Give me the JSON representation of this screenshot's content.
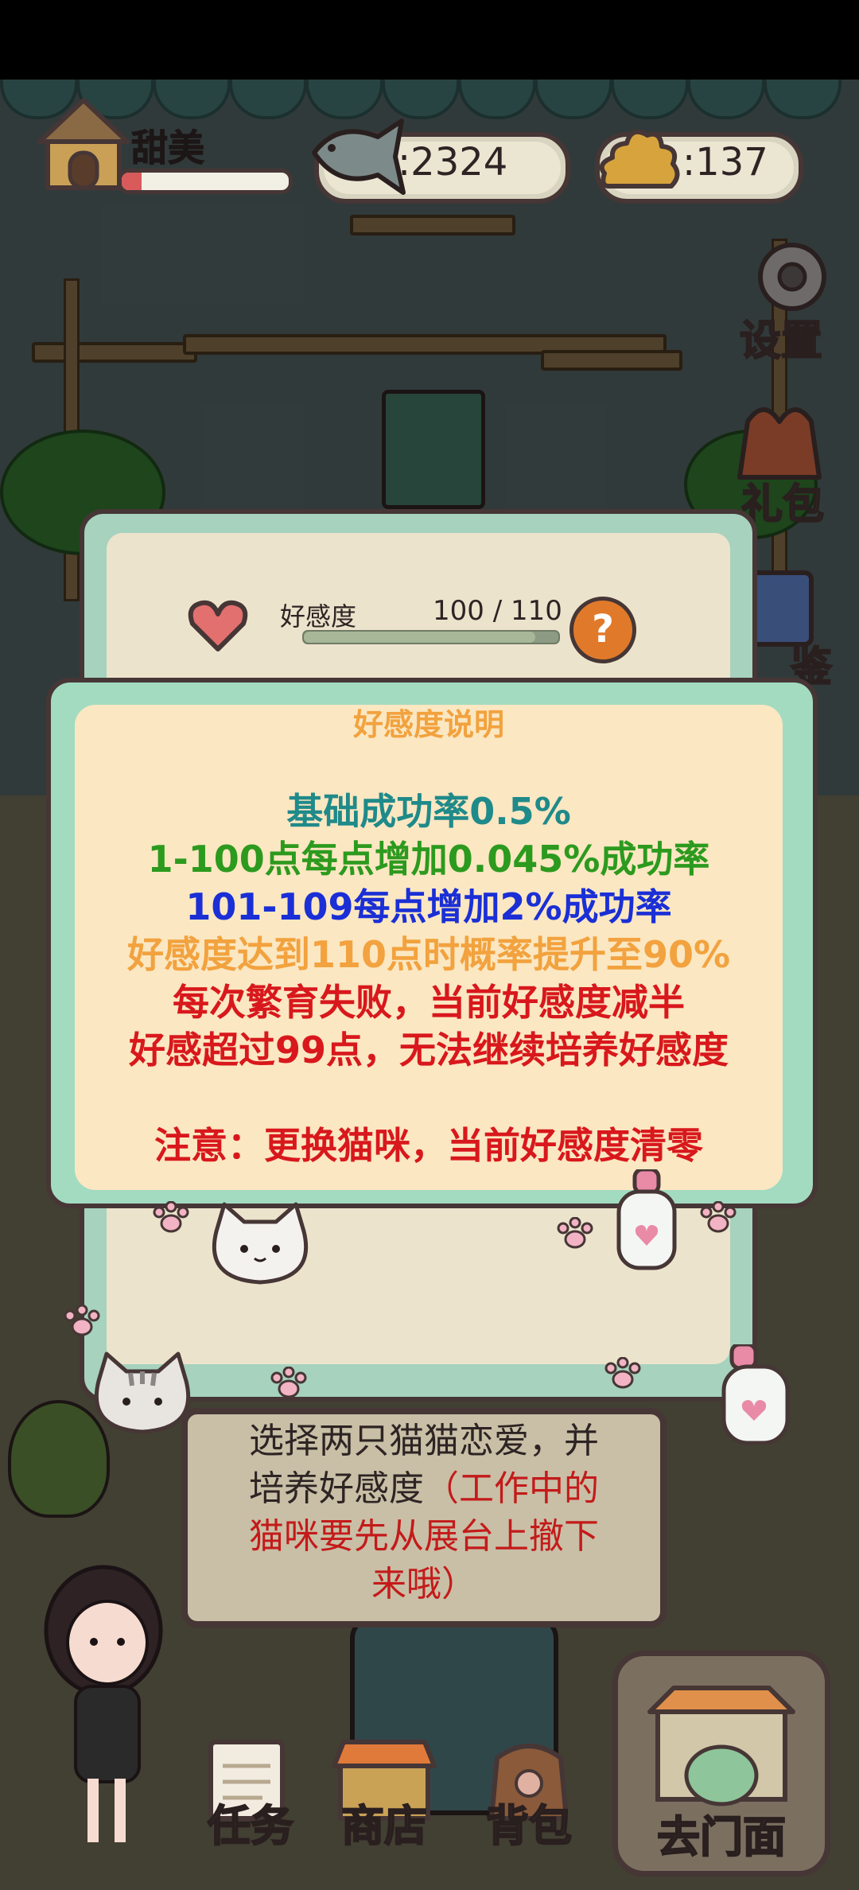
{
  "player": {
    "name": "甜美",
    "level_progress": 0.12
  },
  "resources": {
    "fish_count": "2324",
    "poop_count": "137",
    "fish_icon": "fish-icon",
    "poop_icon": "poop-icon"
  },
  "side_menu": [
    {
      "label": "设置",
      "icon": "gear-icon"
    },
    {
      "label": "礼包",
      "icon": "gift-bag-icon"
    },
    {
      "label": "鉴",
      "icon": "catalog-book-icon"
    }
  ],
  "affection": {
    "label": "好感度",
    "value": "100 / 110",
    "fraction": 0.91,
    "help_icon": "question-icon"
  },
  "dialog": {
    "title": "好感度说明",
    "lines": [
      {
        "text": "基础成功率0.5%",
        "color": "#1f8a8a"
      },
      {
        "text": "1-100点每点增加0.045%成功率",
        "color": "#2c9a1e"
      },
      {
        "text": "101-109每点增加2%成功率",
        "color": "#1a2fd6"
      },
      {
        "text": "好感度达到110点时概率提升至90%",
        "color": "#f2a23e"
      },
      {
        "text": "每次繁育失败，当前好感度减半",
        "color": "#d8181c"
      },
      {
        "text": "好感超过99点，无法继续培养好感度",
        "color": "#d8181c"
      },
      {
        "text": "注意：更换猫咪，当前好感度清零",
        "color": "#d8181c"
      }
    ]
  },
  "hint": {
    "line1": "选择两只猫猫恋爱，并",
    "line2_prefix": "培养好感度",
    "line2_red": "（工作中的",
    "line3_red": "猫咪要先从展台上撤下",
    "line4_red": "来哦）"
  },
  "bottom_nav": [
    {
      "label": "任务",
      "icon": "task-scroll-icon"
    },
    {
      "label": "商店",
      "icon": "shop-icon"
    },
    {
      "label": "背包",
      "icon": "backpack-icon"
    },
    {
      "label": "去门面",
      "icon": "storefront-icon"
    }
  ],
  "colors": {
    "panel_green": "#a3dbc1",
    "panel_cream": "#fbe7c2",
    "outline": "#463635",
    "title_orange": "#f2a23e"
  }
}
